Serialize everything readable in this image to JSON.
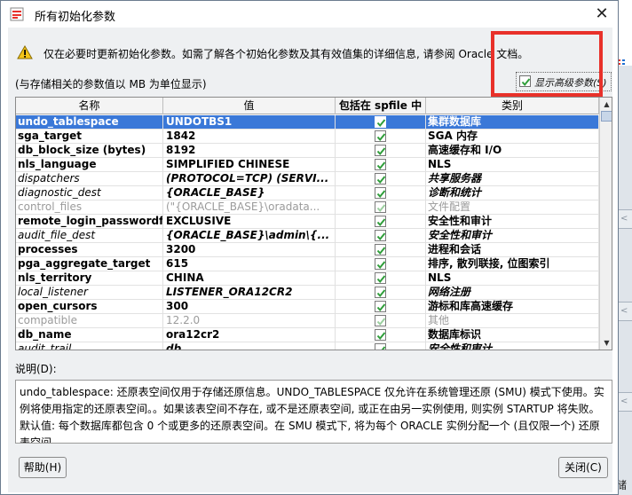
{
  "dialog": {
    "title": "所有初始化参数",
    "close_glyph": "✕"
  },
  "warning": {
    "text": "仅在必要时更新初始化参数。如需了解各个初始化参数及其有效值集的详细信息, 请参阅 Oracle 文档。"
  },
  "unit_note": "(与存储相关的参数值以 MB 为单位显示)",
  "advanced_toggle": {
    "label": "显示高级参数(S)",
    "checked": true
  },
  "table": {
    "headers": {
      "name": "名称",
      "value": "值",
      "spfile": "包括在 spfile 中",
      "category": "类别"
    },
    "rows": [
      {
        "name": "undo_tablespace",
        "value": "UNDOTBS1",
        "spfile": true,
        "category": "集群数据库",
        "selected": true,
        "style": "bold"
      },
      {
        "name": "sga_target",
        "value": "1842",
        "spfile": true,
        "category": "SGA 内存",
        "style": "bold"
      },
      {
        "name": "db_block_size (bytes)",
        "value": "8192",
        "spfile": true,
        "category": "高速缓存和 I/O",
        "style": "bold"
      },
      {
        "name": "nls_language",
        "value": "SIMPLIFIED CHINESE",
        "spfile": true,
        "category": "NLS",
        "style": "bold"
      },
      {
        "name": "dispatchers",
        "value": "(PROTOCOL=TCP) (SERVI...",
        "spfile": true,
        "category": "共享服务器",
        "style": "italic"
      },
      {
        "name": "diagnostic_dest",
        "value": "{ORACLE_BASE}",
        "spfile": true,
        "category": "诊断和统计",
        "style": "italic"
      },
      {
        "name": "control_files",
        "value": "(\"{ORACLE_BASE}\\oradata...",
        "spfile": true,
        "category": "文件配置",
        "style": "disabled"
      },
      {
        "name": "remote_login_passwordfile",
        "value": "EXCLUSIVE",
        "spfile": true,
        "category": "安全性和审计",
        "style": "bold"
      },
      {
        "name": "audit_file_dest",
        "value": "{ORACLE_BASE}\\admin\\{...",
        "spfile": true,
        "category": "安全性和审计",
        "style": "italic"
      },
      {
        "name": "processes",
        "value": "3200",
        "spfile": true,
        "category": "进程和会话",
        "style": "bold"
      },
      {
        "name": "pga_aggregate_target",
        "value": "615",
        "spfile": true,
        "category": "排序, 散列联接, 位图索引",
        "style": "bold"
      },
      {
        "name": "nls_territory",
        "value": "CHINA",
        "spfile": true,
        "category": "NLS",
        "style": "bold"
      },
      {
        "name": "local_listener",
        "value": "LISTENER_ORA12CR2",
        "spfile": true,
        "category": "网络注册",
        "style": "italic"
      },
      {
        "name": "open_cursors",
        "value": "300",
        "spfile": true,
        "category": "游标和库高速缓存",
        "style": "bold"
      },
      {
        "name": "compatible",
        "value": "12.2.0",
        "spfile": true,
        "category": "其他",
        "style": "disabled"
      },
      {
        "name": "db_name",
        "value": "ora12cr2",
        "spfile": true,
        "category": "数据库标识",
        "style": "bold"
      },
      {
        "name": "audit_trail",
        "value": "db",
        "spfile": true,
        "category": "安全性和审计",
        "style": "italic"
      }
    ]
  },
  "description": {
    "label": "说明(D):",
    "text": "undo_tablespace: 还原表空间仅用于存储还原信息。UNDO_TABLESPACE 仅允许在系统管理还原 (SMU) 模式下使用。实例将使用指定的还原表空间。。如果该表空间不存在, 或不是还原表空间, 或正在由另一实例使用, 则实例 STARTUP 将失败。 默认值: 每个数据库都包含 0 个或更多的还原表空间。在 SMU 模式下, 将为每个 ORACLE 实例分配一个 (且仅限一个) 还原表空间。"
  },
  "buttons": {
    "help": "帮助(H)",
    "close": "关闭(C)"
  },
  "background": {
    "side_char": "储"
  },
  "colors": {
    "selection": "#3a78d8",
    "check": "#2f9e3a",
    "highlight_box": "#e8312a"
  }
}
